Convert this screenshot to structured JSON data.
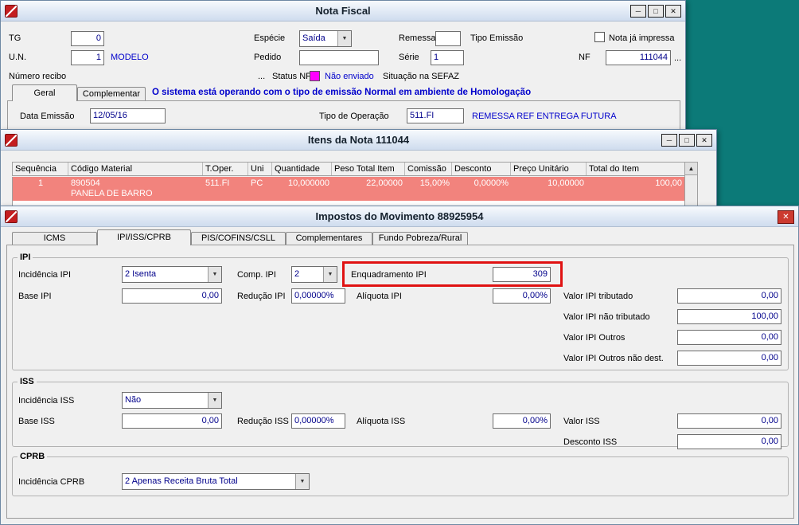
{
  "colors": {
    "desktop_bg": "#0c7a78",
    "status_nfe_swatch": "#ff00ff",
    "highlight_border": "#e01212",
    "item_row_bg": "#f2837d"
  },
  "icons": {
    "chevron_down": "▼",
    "scroll_up": "▲",
    "minimize": "─",
    "maximize": "□",
    "close": "✕",
    "ellipsis": "..."
  },
  "nota_fiscal": {
    "title": "Nota Fiscal",
    "tg_label": "TG",
    "tg_value": "0",
    "especie_label": "Espécie",
    "especie_value": "Saída",
    "remessa_label": "Remessa",
    "remessa_value": "",
    "tipo_emissao_label": "Tipo Emissão",
    "nota_impressa_label": "Nota já impressa",
    "nota_impressa_checked": false,
    "un_label": "U.N.",
    "un_value": "1",
    "un_desc": "MODELO",
    "pedido_label": "Pedido",
    "pedido_value": "",
    "serie_label": "Série",
    "serie_value": "1",
    "nf_label": "NF",
    "nf_value": "111044",
    "numero_recibo_label": "Número recibo",
    "status_nfe_label": "Status NFe",
    "status_nfe_value": "Não enviado",
    "situacao_sefaz_label": "Situação na SEFAZ",
    "tab_geral": "Geral",
    "tab_complementar": "Complementar",
    "homologacao_msg": "O sistema está operando com o tipo de emissão Normal em ambiente de Homologação",
    "data_emissao_label": "Data Emissão",
    "data_emissao_value": "12/05/16",
    "tipo_operacao_label": "Tipo de Operação",
    "tipo_operacao_value": "511.FI",
    "tipo_operacao_desc": "REMESSA REF ENTREGA FUTURA"
  },
  "itens": {
    "title": "Itens da Nota 111044",
    "columns": [
      "Sequência",
      "Código Material",
      "T.Oper.",
      "Uni",
      "Quantidade",
      "Peso Total Item",
      "Comissão",
      "Desconto",
      "Preço Unitário",
      "Total do Item"
    ],
    "row": {
      "sequencia": "1",
      "codigo_material": "890504",
      "descricao": "PANELA DE BARRO",
      "t_oper": "511.FI",
      "uni": "PC",
      "quantidade": "10,000000",
      "peso_total_item": "22,00000",
      "comissao": "15,00%",
      "desconto": "0,0000%",
      "preco_unitario": "10,00000",
      "total_do_item": "100,00"
    }
  },
  "impostos": {
    "title": "Impostos do Movimento 88925954",
    "tabs": [
      "ICMS",
      "IPI/ISS/CPRB",
      "PIS/COFINS/CSLL",
      "Complementares",
      "Fundo Pobreza/Rural"
    ],
    "active_tab": "IPI/ISS/CPRB",
    "ipi": {
      "legend": "IPI",
      "incidencia_label": "Incidência IPI",
      "incidencia_value": "2 Isenta",
      "comp_label": "Comp. IPI",
      "comp_value": "2",
      "enquadramento_label": "Enquadramento IPI",
      "enquadramento_value": "309",
      "base_label": "Base IPI",
      "base_value": "0,00",
      "reducao_label": "Redução IPI",
      "reducao_value": "0,00000%",
      "aliquota_label": "Alíquota IPI",
      "aliquota_value": "0,00%",
      "valor_tributado_label": "Valor IPI tributado",
      "valor_tributado_value": "0,00",
      "valor_nao_tributado_label": "Valor IPI não tributado",
      "valor_nao_tributado_value": "100,00",
      "valor_outros_label": "Valor IPI Outros",
      "valor_outros_value": "0,00",
      "valor_outros_nao_dest_label": "Valor IPI Outros não dest.",
      "valor_outros_nao_dest_value": "0,00"
    },
    "iss": {
      "legend": "ISS",
      "incidencia_label": "Incidência ISS",
      "incidencia_value": "Não",
      "base_label": "Base ISS",
      "base_value": "0,00",
      "reducao_label": "Redução ISS",
      "reducao_value": "0,00000%",
      "aliquota_label": "Alíquota ISS",
      "aliquota_value": "0,00%",
      "valor_label": "Valor ISS",
      "valor_value": "0,00",
      "desconto_label": "Desconto ISS",
      "desconto_value": "0,00"
    },
    "cprb": {
      "legend": "CPRB",
      "incidencia_label": "Incidência CPRB",
      "incidencia_value": "2 Apenas Receita Bruta Total"
    }
  }
}
